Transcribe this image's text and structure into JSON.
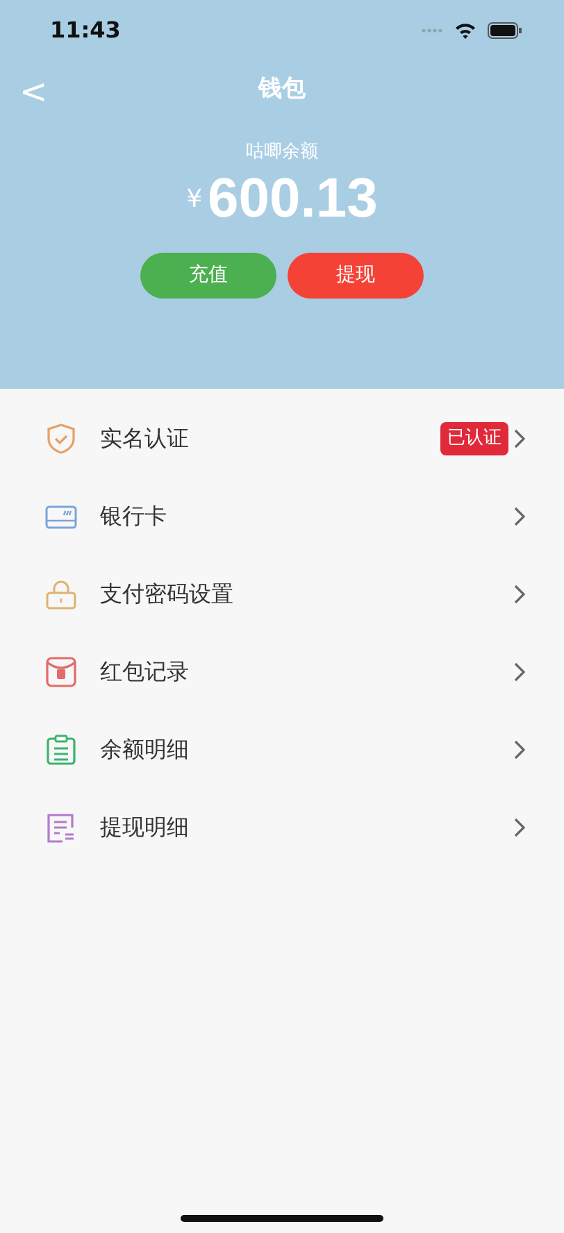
{
  "status_bar": {
    "time": "11:43"
  },
  "header": {
    "title": "钱包",
    "back_icon": "<"
  },
  "balance": {
    "label": "咕唧余额",
    "currency": "¥",
    "amount": "600.13"
  },
  "buttons": [
    {
      "label": "充值",
      "kind": "recharge"
    },
    {
      "label": "提现",
      "kind": "withdraw"
    }
  ],
  "menu": [
    {
      "label": "实名认证",
      "kind": "shield",
      "badge": "已认证"
    },
    {
      "label": "银行卡",
      "kind": "card"
    },
    {
      "label": "支付密码设置",
      "kind": "lock"
    },
    {
      "label": "红包记录",
      "kind": "envelope"
    },
    {
      "label": "余额明细",
      "kind": "clipboard"
    },
    {
      "label": "提现明细",
      "kind": "list"
    }
  ]
}
